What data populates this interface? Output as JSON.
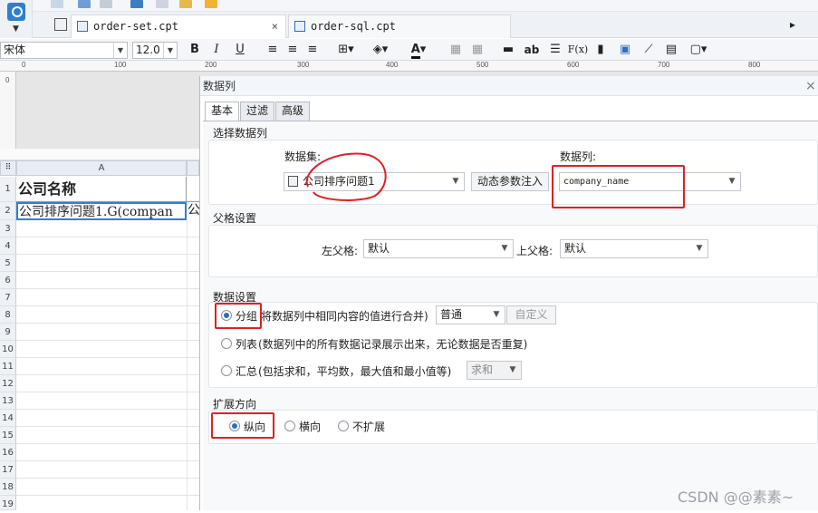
{
  "tabs": [
    {
      "label": "order-set.cpt",
      "active": true
    },
    {
      "label": "order-sql.cpt",
      "active": false
    }
  ],
  "format_bar": {
    "font": "宋体",
    "size": "12.0",
    "bold": "B",
    "italic": "I",
    "underline": "U",
    "text_tool": "ab",
    "formula": "F(x)"
  },
  "ruler": {
    "marks": [
      "0",
      "100",
      "200",
      "300",
      "400",
      "500",
      "600",
      "700",
      "800"
    ]
  },
  "sheet": {
    "column": "A",
    "rows": [
      "1",
      "2",
      "3",
      "4",
      "5",
      "6",
      "7",
      "8",
      "9",
      "10",
      "11",
      "12",
      "13",
      "14",
      "15",
      "16",
      "17",
      "18",
      "19"
    ],
    "cell_a1": "公司名称",
    "cell_a2": "公司排序问题1.G(compan",
    "cell_b2": "公"
  },
  "dialog": {
    "title": "数据列",
    "close": "×",
    "tabs": [
      "基本",
      "过滤",
      "高级"
    ],
    "select_column": {
      "title": "选择数据列",
      "dataset_label": "数据集:",
      "dataset_value": "公司排序问题1",
      "dynamic_button": "动态参数注入",
      "column_label": "数据列:",
      "column_value": "company_name"
    },
    "parent": {
      "title": "父格设置",
      "left_label": "左父格:",
      "left_value": "默认",
      "top_label": "上父格:",
      "top_value": "默认"
    },
    "data_settings": {
      "title": "数据设置",
      "group_label": "分组",
      "group_desc": "将数据列中相同内容的值进行合并)",
      "group_mode": "普通",
      "custom_button": "自定义",
      "list_label": "列表",
      "list_desc": "(数据列中的所有数据记录展示出来，无论数据是否重复)",
      "summary_label": "汇总",
      "summary_desc": "(包括求和，平均数，最大值和最小值等)",
      "summary_mode": "求和"
    },
    "expand": {
      "title": "扩展方向",
      "vertical": "纵向",
      "horizontal": "横向",
      "none": "不扩展"
    }
  },
  "watermark": "CSDN @@素素~",
  "colors": {
    "accent": "#2e6fbf",
    "highlight": "#e02020",
    "selection": "#2f7fd6"
  }
}
